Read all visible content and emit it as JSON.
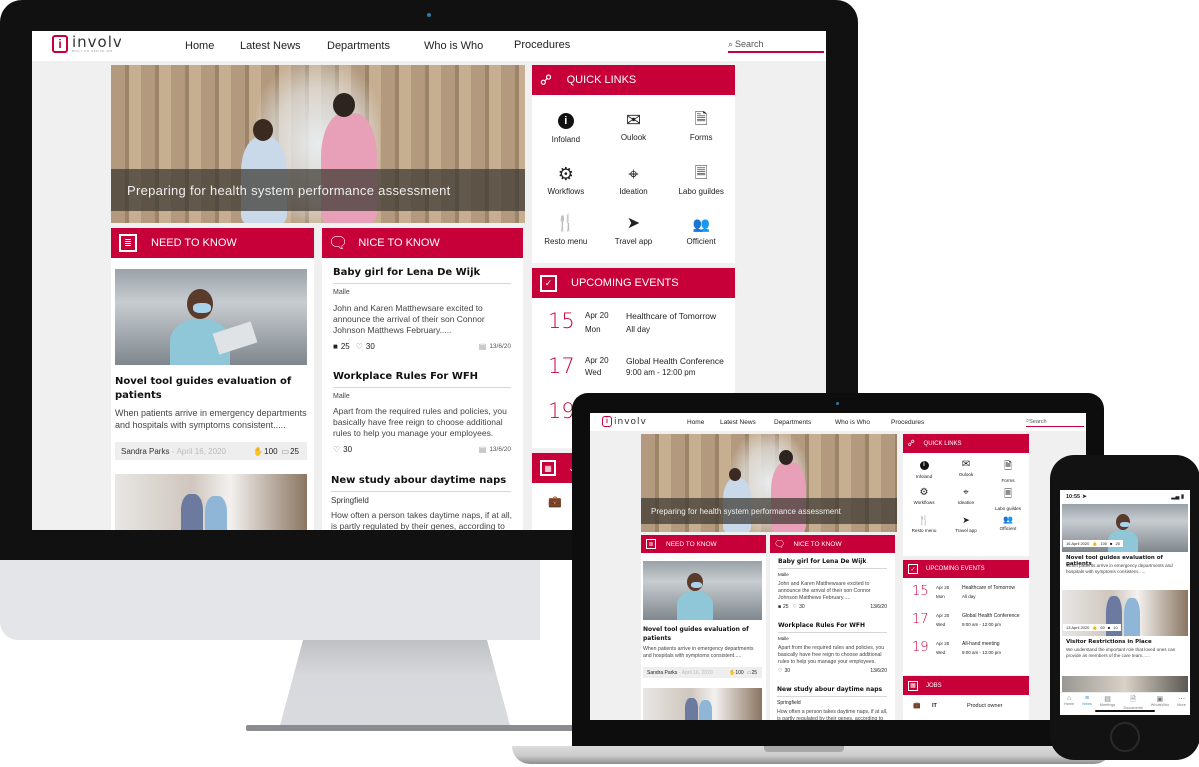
{
  "brand": {
    "name": "involv",
    "tagline": "BUILT ON OFFICE 365",
    "logo_letter": "i",
    "accent_color": "#c8003a"
  },
  "nav": {
    "items": [
      {
        "label": "Home"
      },
      {
        "label": "Latest News"
      },
      {
        "label": "Departments"
      },
      {
        "label": "Who is Who"
      },
      {
        "label": "Procedures"
      }
    ],
    "search_placeholder": "Search"
  },
  "hero": {
    "caption": "Preparing for health system performance assessment"
  },
  "need_to_know": {
    "title": "NEED TO KNOW",
    "articles": [
      {
        "title": "Novel tool guides evaluation of patients",
        "excerpt": "When patients arrive in emergency departments and hospitals with symptoms consistent.....",
        "author": "Sandra Parks",
        "date": "April 16, 2020",
        "likes": "100",
        "comments": "25"
      }
    ]
  },
  "nice_to_know": {
    "title": "NICE TO KNOW",
    "posts": [
      {
        "title": "Baby girl for Lena De Wijk",
        "location": "Malle",
        "excerpt": "John and Karen Matthewsare excited to announce the arrival of their son Connor Johnson Matthews February.....",
        "comments": "25",
        "likes": "30",
        "date": "13/6/20"
      },
      {
        "title": "Workplace Rules For WFH",
        "location": "Malle",
        "excerpt": "Apart from the required rules and policies, you basically have free reign to choose additional rules to help you manage your employees.",
        "likes": "30",
        "date": "13/6/20"
      },
      {
        "title": "New study  abour daytime naps",
        "location": "Springfield",
        "excerpt": "How often a person takes daytime naps, if at all, is partly regulated by their genes, according to"
      }
    ]
  },
  "quick_links": {
    "title": "QUICK LINKS",
    "items": [
      {
        "label": "Infoland",
        "icon": "info-icon"
      },
      {
        "label": "Oulook",
        "icon": "mail-icon"
      },
      {
        "label": "Forms",
        "icon": "forms-icon"
      },
      {
        "label": "Workflows",
        "icon": "gears-icon"
      },
      {
        "label": "Ideation",
        "icon": "crosshair-icon"
      },
      {
        "label": "Labo guildes",
        "icon": "document-icon"
      },
      {
        "label": "Resto menu",
        "icon": "restaurant-icon"
      },
      {
        "label": "Travel app",
        "icon": "paper-plane-icon"
      },
      {
        "label": "Officient",
        "icon": "people-icon"
      }
    ]
  },
  "events": {
    "title": "UPCOMING EVENTS",
    "items": [
      {
        "day": "15",
        "month": "Apr 20",
        "weekday": "Mon",
        "name": "Healthcare of Tomorrow",
        "time": "All day"
      },
      {
        "day": "17",
        "month": "Apr 20",
        "weekday": "Wed",
        "name": "Global Health Conference",
        "time": "9:00 am - 12:00 pm"
      },
      {
        "day": "19",
        "month": "Apr 20",
        "weekday": "Wed",
        "name": "All-hand meeting",
        "time": "9:00 am - 12:00 pm"
      }
    ]
  },
  "jobs": {
    "title": "JOBS",
    "items": [
      {
        "department": "IT",
        "role": "Product owner"
      }
    ]
  },
  "mobile": {
    "time": "10:55",
    "news": [
      {
        "date": "16 April 2020",
        "likes": "100",
        "comments": "25",
        "title": "Novel tool guides evaluation of patients",
        "excerpt": "When patients arrive in emergency departments and hospitals with symptoms consistent......"
      },
      {
        "date": "13 April 2020",
        "likes": "60",
        "comments": "10",
        "title": "Visitor Restrictions in Place",
        "excerpt": "We understand the important role that loved ones can provide as members of the care team......"
      }
    ],
    "tabs": [
      {
        "label": "Home",
        "icon": "home-icon"
      },
      {
        "label": "News",
        "icon": "news-icon",
        "active": true
      },
      {
        "label": "Meetings",
        "icon": "calendar-icon"
      },
      {
        "label": "Documents",
        "icon": "document-icon"
      },
      {
        "label": "WhoisWho",
        "icon": "contact-icon"
      },
      {
        "label": "More",
        "icon": "more-icon"
      }
    ]
  }
}
